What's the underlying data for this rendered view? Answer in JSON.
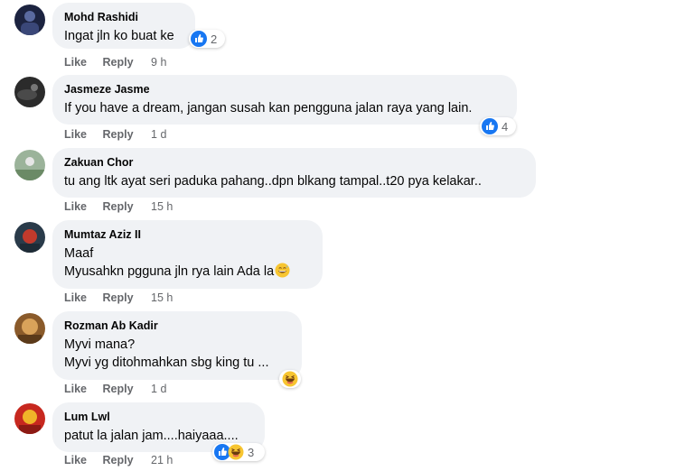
{
  "actions": {
    "like_label": "Like",
    "reply_label": "Reply"
  },
  "colors": {
    "bubble": "#f0f2f5",
    "meta": "#65676b",
    "like_blue": "#1877f2"
  },
  "comments": [
    {
      "author": "Mohd Rashidi",
      "lines": [
        "Ingat jln ko buat ke"
      ],
      "time": "9 h",
      "reactions": {
        "icons": [
          "like-icon"
        ],
        "count": "2"
      }
    },
    {
      "author": "Jasmeze Jasme",
      "lines": [
        "If you have a dream, jangan susah kan pengguna jalan raya yang lain."
      ],
      "time": "1 d",
      "reactions": {
        "icons": [
          "like-icon"
        ],
        "count": "4"
      }
    },
    {
      "author": "Zakuan Chor",
      "lines": [
        "tu ang ltk ayat seri paduka pahang..dpn blkang tampal..t20 pya kelakar.."
      ],
      "time": "15 h"
    },
    {
      "author": "Mumtaz Aziz II",
      "lines": [
        "Maaf",
        "Myusahkn pgguna jln rya lain Ada la"
      ],
      "inline_emoji": "grinning-sweat-emoji",
      "time": "15 h"
    },
    {
      "author": "Rozman Ab Kadir",
      "lines": [
        "Myvi mana?",
        "Myvi yg ditohmahkan sbg king tu ..."
      ],
      "time": "1 d",
      "reactions": {
        "icons": [
          "haha-icon"
        ],
        "count": ""
      }
    },
    {
      "author": "Lum Lwl",
      "lines": [
        "patut la jalan jam....haiyaaa...."
      ],
      "time": "21 h",
      "reactions": {
        "icons": [
          "like-icon",
          "haha-icon"
        ],
        "count": "3"
      }
    }
  ]
}
